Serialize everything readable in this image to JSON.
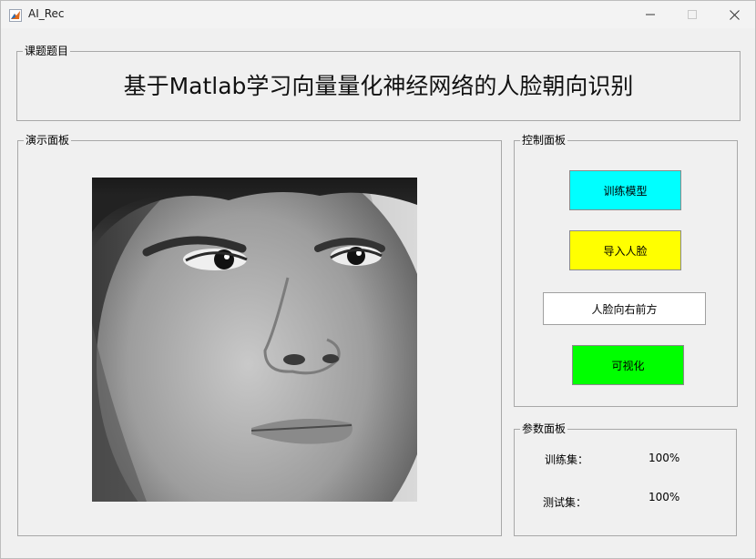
{
  "window": {
    "title": "AI_Rec",
    "icon": "matlab-icon"
  },
  "topic_panel": {
    "legend": "课题题目",
    "title": "基于Matlab学习向量量化神经网络的人脸朝向识别"
  },
  "demo_panel": {
    "legend": "演示面板",
    "image_description": "face-photo"
  },
  "control_panel": {
    "legend": "控制面板",
    "train_button": "训练模型",
    "import_button": "导入人脸",
    "result_text": "人脸向右前方",
    "visualize_button": "可视化",
    "colors": {
      "train": "#00ffff",
      "import": "#ffff00",
      "visualize": "#00ff00"
    }
  },
  "param_panel": {
    "legend": "参数面板",
    "train_label": "训练集：",
    "train_value": "100%",
    "test_label": "测试集：",
    "test_value": "100%"
  }
}
